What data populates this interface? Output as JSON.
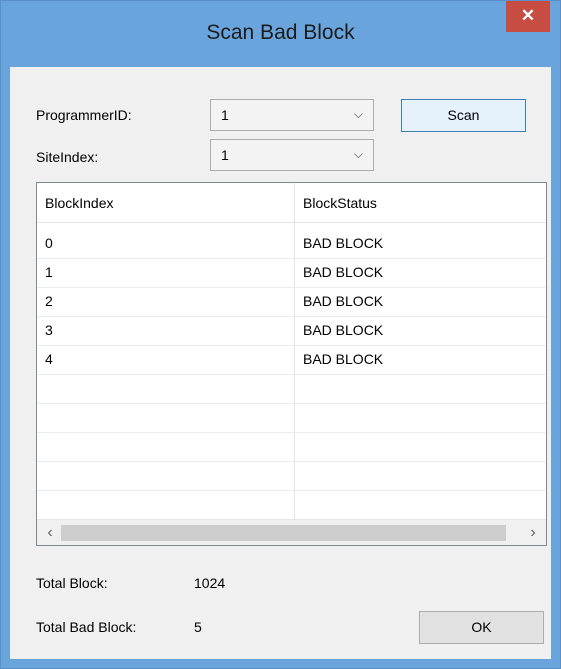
{
  "window": {
    "title": "Scan Bad Block",
    "close_glyph": "✕"
  },
  "form": {
    "programmer_label": "ProgrammerID:",
    "programmer_value": "1",
    "site_label": "SiteIndex:",
    "site_value": "1",
    "scan_label": "Scan",
    "chevron": "⌵"
  },
  "grid": {
    "columns": [
      "BlockIndex",
      "BlockStatus"
    ],
    "rows": [
      {
        "index": "0",
        "status": "BAD BLOCK"
      },
      {
        "index": "1",
        "status": "BAD BLOCK"
      },
      {
        "index": "2",
        "status": "BAD BLOCK"
      },
      {
        "index": "3",
        "status": "BAD BLOCK"
      },
      {
        "index": "4",
        "status": "BAD BLOCK"
      },
      {
        "index": "",
        "status": ""
      },
      {
        "index": "",
        "status": ""
      },
      {
        "index": "",
        "status": ""
      },
      {
        "index": "",
        "status": ""
      },
      {
        "index": "",
        "status": ""
      }
    ],
    "scroll_left": "‹",
    "scroll_right": "›"
  },
  "summary": {
    "total_block_label": "Total Block:",
    "total_block_value": "1024",
    "total_bad_label": "Total Bad Block:",
    "total_bad_value": "5"
  },
  "ok_label": "OK",
  "colors": {
    "title_bar": "#6aa4dd",
    "close": "#c74c41",
    "client": "#f0f0f0"
  }
}
